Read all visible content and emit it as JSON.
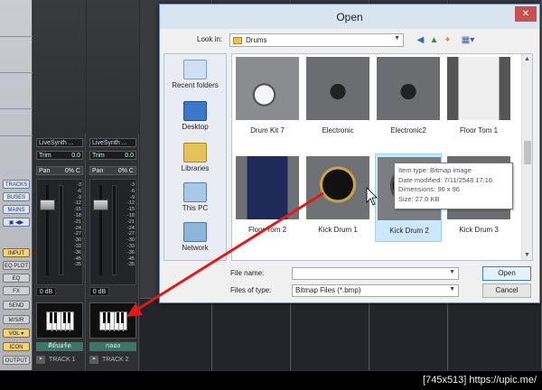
{
  "daw": {
    "side_buttons": [
      "TRACKS",
      "BUSES",
      "MAINS",
      "▣ ◀▶",
      "INPUT",
      "EQ PLOT",
      "EQ",
      "FX",
      "SEND",
      "M/S/R",
      "VOL ▾",
      "ICON",
      "OUTPUT"
    ],
    "strips": [
      {
        "synth": "LiveSynth ...",
        "trim_label": "Trim",
        "trim_value": "0.0",
        "pan_label": "Pan",
        "pan_value": "0% C",
        "db": "0 dB",
        "name": "คีย์บอร์ด",
        "oo": "⚭",
        "track": "TRACK 1"
      },
      {
        "synth": "LiveSynth ...",
        "trim_label": "Trim",
        "trim_value": "0.0",
        "pan_label": "Pan",
        "pan_value": "0% C",
        "db": "0 dB",
        "name": "กลอง",
        "oo": "⚭",
        "track": "TRACK 2"
      }
    ],
    "meter_scale": [
      "-3",
      "-6",
      "-9",
      "-12",
      "-15",
      "-18",
      "-21",
      "-24",
      "-27",
      "-30",
      "-33",
      "-36",
      "-45",
      "-35"
    ]
  },
  "dialog": {
    "title": "Open",
    "close_glyph": "✕",
    "lookin_label": "Look in:",
    "lookin_value": "Drums",
    "places": [
      "Recent folders",
      "Desktop",
      "Libraries",
      "This PC",
      "Network"
    ],
    "files": [
      {
        "name": "Drum Kit 7",
        "thumb": "drumkit"
      },
      {
        "name": "Electronic",
        "thumb": "electronic"
      },
      {
        "name": "Electronic2",
        "thumb": "electronic"
      },
      {
        "name": "Floor Tom 1",
        "thumb": "floortom-white"
      },
      {
        "name": "Floor Tom 2",
        "thumb": "floortom-blue"
      },
      {
        "name": "Kick Drum 1",
        "thumb": "kick-gold"
      },
      {
        "name": "Kick Drum 2",
        "thumb": "kick-black"
      },
      {
        "name": "Kick Drum 3",
        "thumb": "kick-grey"
      }
    ],
    "tooltip": {
      "type": "Item type: Bitmap image",
      "modified": "Date modified: 7/11/2548 17:16",
      "dimensions": "Dimensions: 96 x 96",
      "size": "Size: 27.0 KB"
    },
    "file_name_label": "File name:",
    "file_name_value": "",
    "files_of_type_label": "Files of type:",
    "files_of_type_value": "Bitmap Files (*.bmp)",
    "open_label": "Open",
    "cancel_label": "Cancel"
  },
  "footer": {
    "text": "[745x513] https://upic.me/"
  },
  "colors": {
    "arrow": "#e01a1a",
    "dialog_title_bg": "#d9e4f1",
    "selection_bg": "#cce8ff",
    "track_name_bg": "#3f7567"
  }
}
